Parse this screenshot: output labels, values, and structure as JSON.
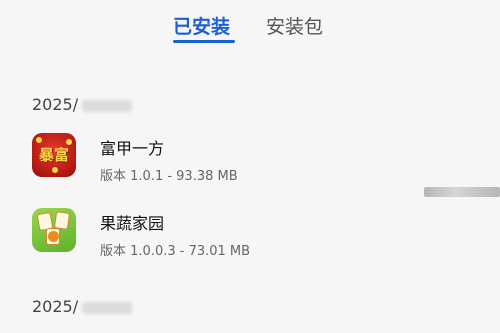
{
  "tabs": [
    {
      "label": "已安装",
      "active": true
    },
    {
      "label": "安装包",
      "active": false
    }
  ],
  "accent_color": "#1b5fd6",
  "groups": [
    {
      "date": "2025/",
      "apps": [
        {
          "name": "富甲一方",
          "meta": "版本 1.0.1 - 93.38 MB",
          "icon": "fujiayifang-app-icon",
          "icon_text": "暴富"
        },
        {
          "name": "果蔬家园",
          "meta": "版本 1.0.0.3 - 73.01 MB",
          "icon": "guoshujiayuan-app-icon"
        }
      ]
    },
    {
      "date": "2025/",
      "apps": []
    }
  ]
}
